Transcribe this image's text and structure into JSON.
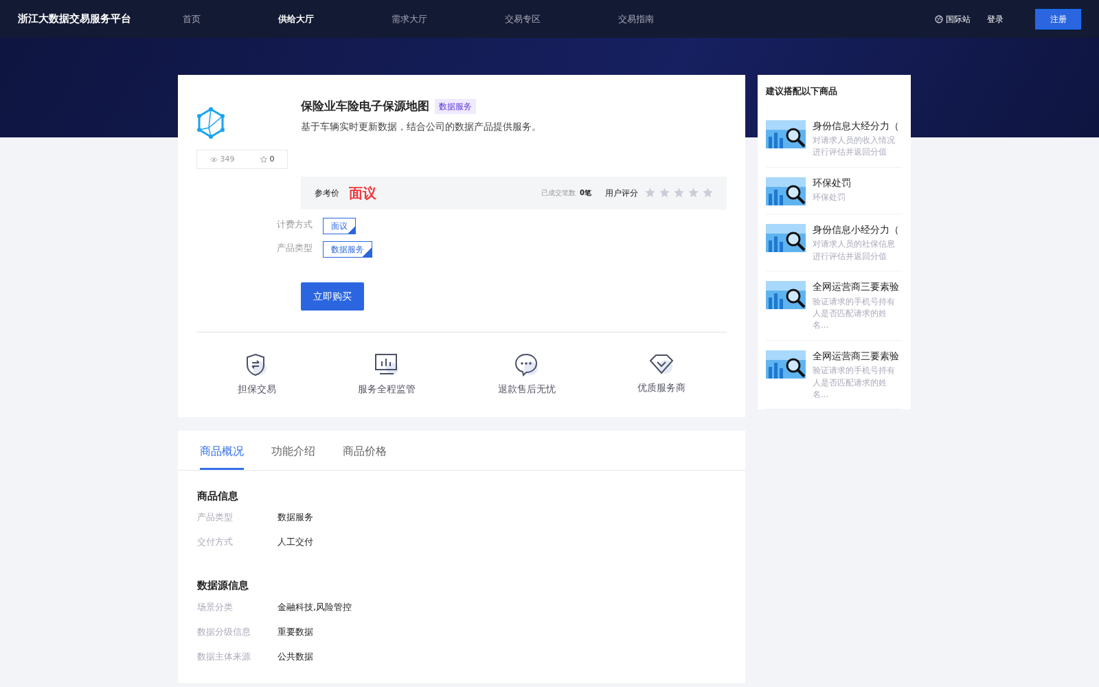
{
  "navbar": {
    "brand": "浙江大数据交易服务平台",
    "links": [
      {
        "label": "首页",
        "selected": false
      },
      {
        "label": "供给大厅",
        "selected": true
      },
      {
        "label": "需求大厅",
        "selected": false
      },
      {
        "label": "交易专区",
        "selected": false
      },
      {
        "label": "交易指南",
        "selected": false
      }
    ],
    "intl": "国际站",
    "login": "登录",
    "register": "注册"
  },
  "product": {
    "title": "保险业车险电子保源地图",
    "tag": "数据服务",
    "description": "基于车辆实时更新数据，结合公司的数据产品提供服务。",
    "views": "349",
    "favorites": "0",
    "price_label": "参考价",
    "price": "面议",
    "deals_label": "已成交笔数",
    "deals": "0笔",
    "rating_label": "用户评分",
    "stars": 0,
    "options": [
      {
        "label": "计费方式",
        "value": "面议"
      },
      {
        "label": "产品类型",
        "value": "数据服务"
      }
    ],
    "buy": "立即购买"
  },
  "guarantees": [
    {
      "kind": "shield",
      "label": "担保交易"
    },
    {
      "kind": "monitor",
      "label": "服务全程监管"
    },
    {
      "kind": "chat",
      "label": "退款售后无忧"
    },
    {
      "kind": "diamond",
      "label": "优质服务商"
    }
  ],
  "tabs": [
    {
      "label": "商品概况",
      "selected": true
    },
    {
      "label": "功能介绍",
      "selected": false
    },
    {
      "label": "商品价格",
      "selected": false
    }
  ],
  "sections": [
    {
      "title": "商品信息",
      "rows": [
        {
          "label": "产品类型",
          "value": "数据服务"
        },
        {
          "label": "交付方式",
          "value": "人工交付"
        }
      ]
    },
    {
      "title": "数据源信息",
      "rows": [
        {
          "label": "场景分类",
          "value": "金融科技,风险管控"
        },
        {
          "label": "数据分级信息",
          "value": "重要数据"
        },
        {
          "label": "数据主体来源",
          "value": "公共数据"
        }
      ]
    }
  ],
  "recommend": {
    "title": "建议搭配以下商品",
    "items": [
      {
        "kind": "picture",
        "name": "身份信息大经分力（",
        "description": "对请求人员的收入情况进行评估并返回分值"
      },
      {
        "kind": "picture",
        "name": "环保处罚",
        "description": "环保处罚"
      },
      {
        "kind": "picture",
        "name": "身份信息小经分力（",
        "description": "对请求人员的社保信息进行评估并返回分值"
      },
      {
        "kind": "picture",
        "name": "全网运营商三要素验",
        "description": "验证请求的手机号持有人是否匹配请求的姓名..."
      },
      {
        "kind": "picture",
        "name": "全网运营商三要素验",
        "description": "验证请求的手机号持有人是否匹配请求的姓名..."
      }
    ]
  }
}
